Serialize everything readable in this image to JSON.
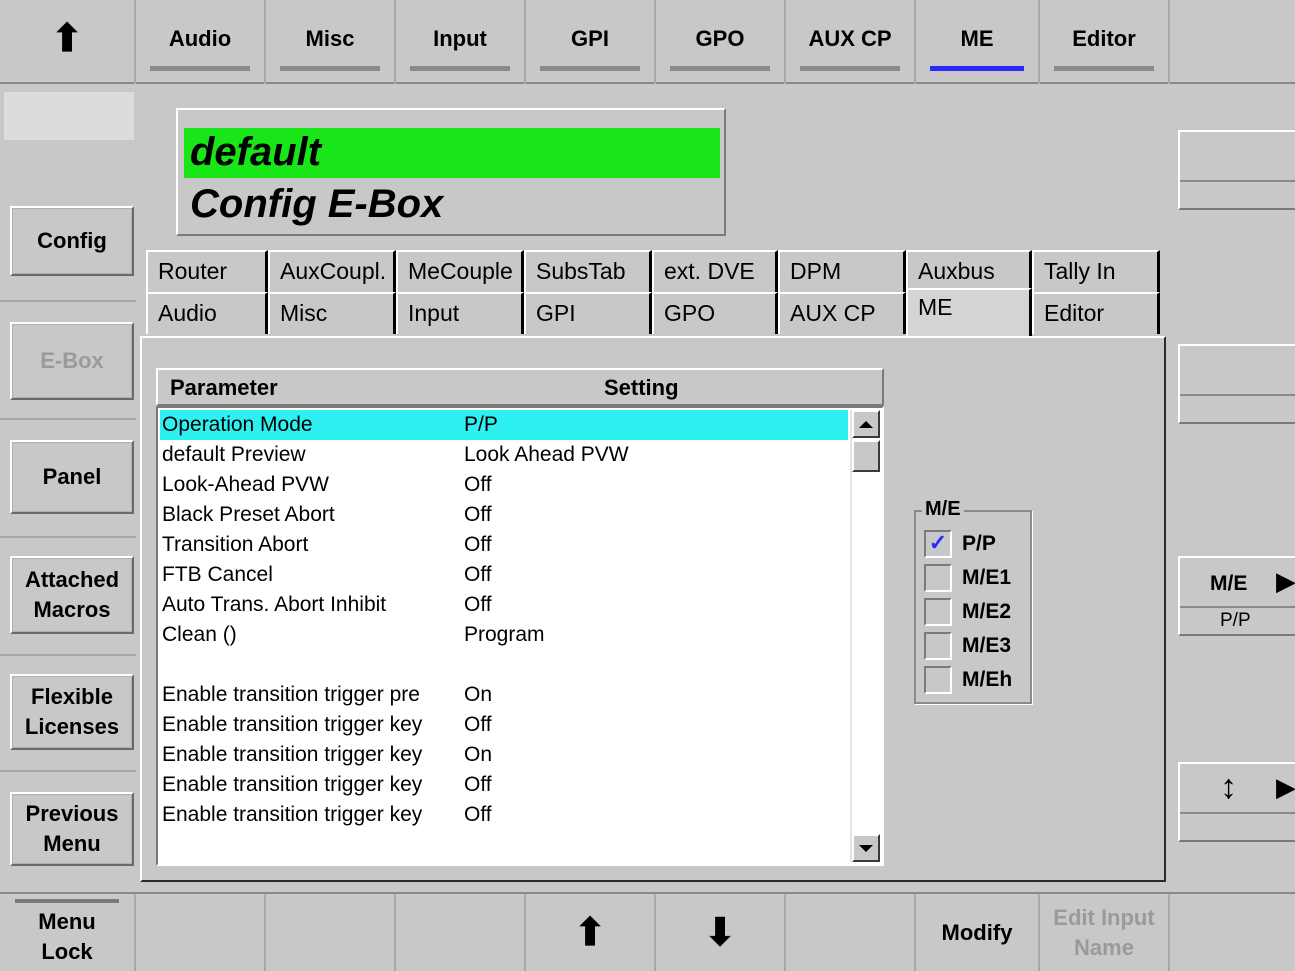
{
  "top_tabs": [
    "Audio",
    "Misc",
    "Input",
    "GPI",
    "GPO",
    "AUX CP",
    "ME",
    "Editor"
  ],
  "top_active": "ME",
  "left_menu": {
    "config": "Config",
    "ebox": "E-Box",
    "panel": "Panel",
    "attached_macros": [
      "Attached",
      "Macros"
    ],
    "flexible_licenses": [
      "Flexible",
      "Licenses"
    ],
    "previous_menu": [
      "Previous",
      "Menu"
    ]
  },
  "header": {
    "line1": "default",
    "line2": "Config E-Box"
  },
  "tabs_row1": [
    "Router",
    "AuxCoupl.",
    "MeCouple",
    "SubsTab",
    "ext. DVE",
    "DPM",
    "Auxbus",
    "Tally In"
  ],
  "tabs_row2": [
    "Audio",
    "Misc",
    "Input",
    "GPI",
    "GPO",
    "AUX CP",
    "ME",
    "Editor"
  ],
  "list": {
    "col_parameter": "Parameter",
    "col_setting": "Setting",
    "rows": [
      {
        "parameter": "Operation Mode",
        "setting": "P/P"
      },
      {
        "parameter": "default Preview",
        "setting": "Look Ahead PVW"
      },
      {
        "parameter": "Look-Ahead PVW",
        "setting": "Off"
      },
      {
        "parameter": "Black Preset Abort",
        "setting": "Off"
      },
      {
        "parameter": "Transition Abort",
        "setting": "Off"
      },
      {
        "parameter": "FTB Cancel",
        "setting": "Off"
      },
      {
        "parameter": "Auto Trans. Abort Inhibit",
        "setting": "Off"
      },
      {
        "parameter": "Clean ()",
        "setting": "Program"
      },
      {
        "parameter": "",
        "setting": ""
      },
      {
        "parameter": "Enable transition trigger pre",
        "setting": "On"
      },
      {
        "parameter": "Enable transition trigger key",
        "setting": "Off"
      },
      {
        "parameter": "Enable transition trigger key",
        "setting": "On"
      },
      {
        "parameter": "Enable transition trigger key",
        "setting": "Off"
      },
      {
        "parameter": "Enable transition trigger key",
        "setting": "Off"
      }
    ]
  },
  "me_group": {
    "title": "M/E",
    "options": [
      {
        "label": "P/P",
        "checked": true
      },
      {
        "label": "M/E1",
        "checked": false
      },
      {
        "label": "M/E2",
        "checked": false
      },
      {
        "label": "M/E3",
        "checked": false
      },
      {
        "label": "M/Eh",
        "checked": false
      }
    ]
  },
  "right_panel": {
    "me_label": "M/E",
    "me_value": "P/P"
  },
  "bottom": {
    "menu_lock": [
      "Menu",
      "Lock"
    ],
    "modify": "Modify",
    "edit_input_name": [
      "Edit Input",
      "Name"
    ]
  },
  "glyphs": {
    "up": "⬆",
    "down": "⬇",
    "updown": "↕",
    "right": "▶",
    "check": "✓"
  }
}
